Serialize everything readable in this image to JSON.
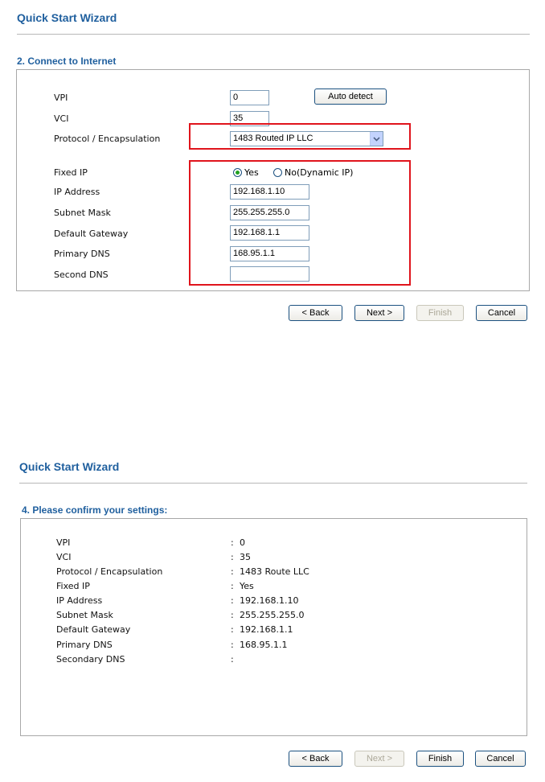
{
  "step2": {
    "wizard_title": "Quick Start Wizard",
    "section_title": "2. Connect to Internet",
    "vpi_label": "VPI",
    "vpi_value": "0",
    "auto_detect": "Auto detect",
    "vci_label": "VCI",
    "vci_value": "35",
    "protocol_label": "Protocol / Encapsulation",
    "protocol_value": "1483 Routed IP LLC",
    "fixed_ip_label": "Fixed IP",
    "fixed_ip_yes": "Yes",
    "fixed_ip_no": "No(Dynamic IP)",
    "fixed_ip_selected": "Yes",
    "ip_label": "IP Address",
    "ip_value": "192.168.1.10",
    "mask_label": "Subnet Mask",
    "mask_value": "255.255.255.0",
    "gateway_label": "Default Gateway",
    "gateway_value": "192.168.1.1",
    "primary_dns_label": "Primary DNS",
    "primary_dns_value": "168.95.1.1",
    "second_dns_label": "Second DNS",
    "second_dns_value": "",
    "buttons": {
      "back": "< Back",
      "next": "Next >",
      "finish": "Finish",
      "cancel": "Cancel"
    }
  },
  "step4": {
    "wizard_title": "Quick Start Wizard",
    "section_title": "4. Please confirm your settings:",
    "rows": [
      {
        "label": "VPI",
        "value": "0"
      },
      {
        "label": "VCI",
        "value": "35"
      },
      {
        "label": "Protocol / Encapsulation",
        "value": "1483 Route LLC"
      },
      {
        "label": "Fixed IP",
        "value": "Yes"
      },
      {
        "label": "IP Address",
        "value": "192.168.1.10"
      },
      {
        "label": "Subnet Mask",
        "value": "255.255.255.0"
      },
      {
        "label": "Default Gateway",
        "value": "192.168.1.1"
      },
      {
        "label": "Primary DNS",
        "value": "168.95.1.1"
      },
      {
        "label": "Secondary DNS",
        "value": ""
      }
    ],
    "separator": ":",
    "buttons": {
      "back": "< Back",
      "next": "Next >",
      "finish": "Finish",
      "cancel": "Cancel"
    }
  },
  "colors": {
    "title_blue": "#1f5f9e",
    "highlight_red": "#e0141c",
    "radio_green": "#21a121"
  },
  "icons": {
    "dropdown": "chevron-down-icon",
    "radio": "radio-button-icon"
  }
}
